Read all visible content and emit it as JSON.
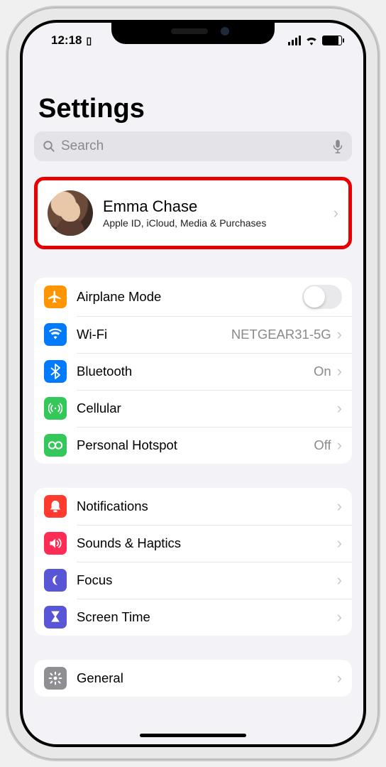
{
  "status": {
    "time": "12:18",
    "indicator_glyph": "▯"
  },
  "page": {
    "title": "Settings",
    "search_placeholder": "Search"
  },
  "profile": {
    "name": "Emma Chase",
    "subtitle": "Apple ID, iCloud, Media & Purchases"
  },
  "groups": [
    {
      "rows": [
        {
          "icon": "airplane-icon",
          "label": "Airplane Mode",
          "type": "toggle",
          "value": "off",
          "bg": "bg-orange"
        },
        {
          "icon": "wifi-icon",
          "label": "Wi-Fi",
          "type": "link",
          "value": "NETGEAR31-5G",
          "bg": "bg-blue"
        },
        {
          "icon": "bluetooth-icon",
          "label": "Bluetooth",
          "type": "link",
          "value": "On",
          "bg": "bg-blue"
        },
        {
          "icon": "cellular-icon",
          "label": "Cellular",
          "type": "link",
          "value": "",
          "bg": "bg-green"
        },
        {
          "icon": "hotspot-icon",
          "label": "Personal Hotspot",
          "type": "link",
          "value": "Off",
          "bg": "bg-green"
        }
      ]
    },
    {
      "rows": [
        {
          "icon": "notifications-icon",
          "label": "Notifications",
          "type": "link",
          "value": "",
          "bg": "bg-red"
        },
        {
          "icon": "sounds-icon",
          "label": "Sounds & Haptics",
          "type": "link",
          "value": "",
          "bg": "bg-pink"
        },
        {
          "icon": "focus-icon",
          "label": "Focus",
          "type": "link",
          "value": "",
          "bg": "bg-indigo"
        },
        {
          "icon": "screentime-icon",
          "label": "Screen Time",
          "type": "link",
          "value": "",
          "bg": "bg-indigo"
        }
      ]
    },
    {
      "rows": [
        {
          "icon": "general-icon",
          "label": "General",
          "type": "link",
          "value": "",
          "bg": "bg-gray"
        }
      ]
    }
  ]
}
